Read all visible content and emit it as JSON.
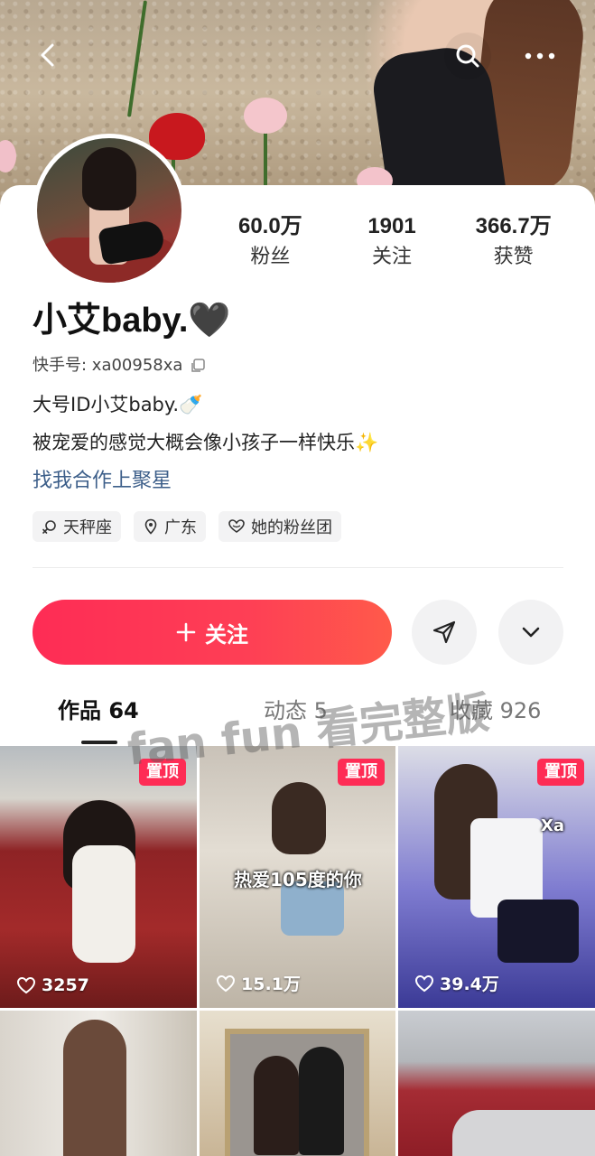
{
  "profile": {
    "name": "小艾baby.🖤",
    "kuaishou_id": "快手号: xa00958xa",
    "bio_line1": "大号ID小艾baby.🍼",
    "bio_line2": "被宠爱的感觉大概会像小孩子一样快乐✨",
    "collab_link": "找我合作上聚星"
  },
  "stats": [
    {
      "value": "60.0万",
      "label": "粉丝"
    },
    {
      "value": "1901",
      "label": "关注"
    },
    {
      "value": "366.7万",
      "label": "获赞"
    }
  ],
  "tags": [
    {
      "label": "天秤座",
      "icon": "gender-symbol-icon"
    },
    {
      "label": "广东",
      "icon": "location-pin-icon"
    },
    {
      "label": "她的粉丝团",
      "icon": "fan-club-heart-icon"
    }
  ],
  "actions": {
    "follow_label": "关注",
    "follow_prefix": "+"
  },
  "tabs": [
    {
      "label": "作品 64"
    },
    {
      "label": "动态 5"
    },
    {
      "label": "收藏 926"
    }
  ],
  "watermark": "fan fun 看完整版",
  "posts": [
    {
      "pinned_label": "置顶",
      "likes": "3257"
    },
    {
      "pinned_label": "置顶",
      "likes": "15.1万",
      "overlay": "热爱105度的你"
    },
    {
      "pinned_label": "置顶",
      "likes": "39.4万",
      "overlay": "Xa"
    },
    {
      "likes": ""
    },
    {
      "likes": ""
    },
    {
      "likes": ""
    }
  ],
  "colors": {
    "accent": "#fe2c55",
    "link": "#3d5f8a"
  }
}
